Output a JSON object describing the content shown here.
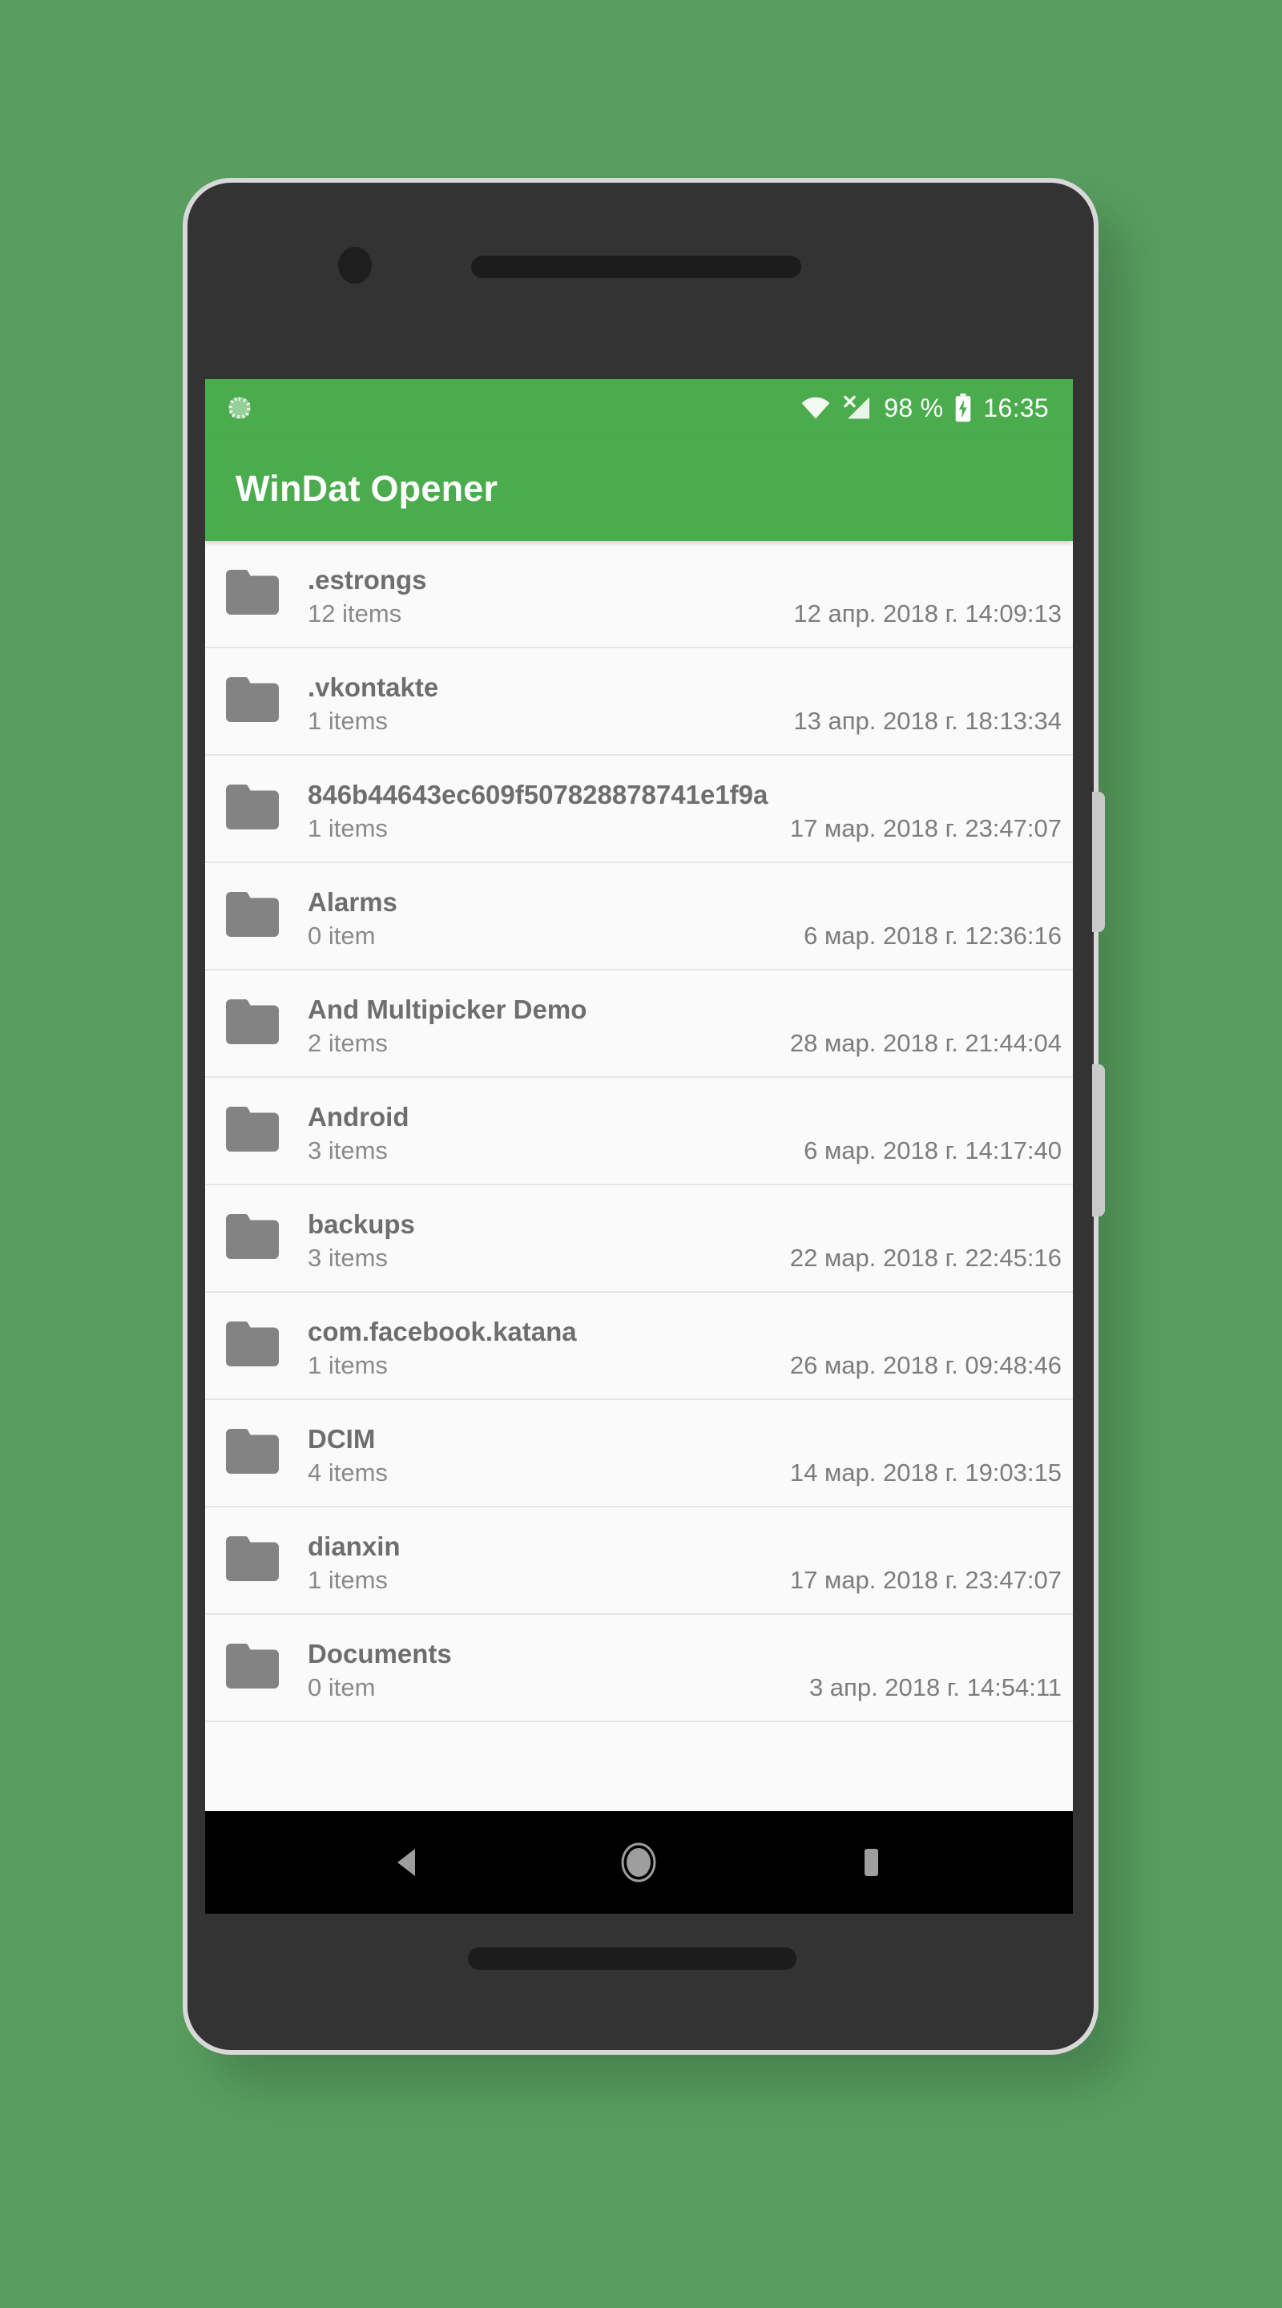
{
  "colors": {
    "background_green": "#589e5f",
    "app_bar_green": "#4bac4e",
    "screen_background": "#fafafa",
    "folder_icon_gray": "#838383",
    "nav_bar_black": "#000000"
  },
  "device": {
    "frame_label": "android-phone-frame",
    "front_camera": "front-camera",
    "earpiece": "earpiece-speaker",
    "bottom_speaker": "bottom-speaker",
    "power_button": "power-button",
    "volume_button": "volume-button"
  },
  "status_bar": {
    "sync_icon": "sync-spinner-icon",
    "wifi_icon": "wifi-icon",
    "signal_icon": "cellular-signal-off-icon",
    "battery_percent": "98 %",
    "battery_icon": "battery-charging-icon",
    "clock": "16:35"
  },
  "app_bar": {
    "title": "WinDat Opener"
  },
  "file_list": {
    "rows": [
      {
        "name": ".estrongs",
        "count": "12 items",
        "date": "12 апр. 2018 г. 14:09:13",
        "icon": "folder-icon"
      },
      {
        "name": ".vkontakte",
        "count": "1 items",
        "date": "13 апр. 2018 г. 18:13:34",
        "icon": "folder-icon"
      },
      {
        "name": "846b44643ec609f507828878741e1f9a",
        "count": "1 items",
        "date": "17 мар. 2018 г. 23:47:07",
        "icon": "folder-icon"
      },
      {
        "name": "Alarms",
        "count": "0 item",
        "date": "6 мар. 2018 г. 12:36:16",
        "icon": "folder-icon"
      },
      {
        "name": "And Multipicker Demo",
        "count": "2 items",
        "date": "28 мар. 2018 г. 21:44:04",
        "icon": "folder-icon"
      },
      {
        "name": "Android",
        "count": "3 items",
        "date": "6 мар. 2018 г. 14:17:40",
        "icon": "folder-icon"
      },
      {
        "name": "backups",
        "count": "3 items",
        "date": "22 мар. 2018 г. 22:45:16",
        "icon": "folder-icon"
      },
      {
        "name": "com.facebook.katana",
        "count": "1 items",
        "date": "26 мар. 2018 г. 09:48:46",
        "icon": "folder-icon"
      },
      {
        "name": "DCIM",
        "count": "4 items",
        "date": "14 мар. 2018 г. 19:03:15",
        "icon": "folder-icon"
      },
      {
        "name": "dianxin",
        "count": "1 items",
        "date": "17 мар. 2018 г. 23:47:07",
        "icon": "folder-icon"
      },
      {
        "name": "Documents",
        "count": "0 item",
        "date": "3 апр. 2018 г. 14:54:11",
        "icon": "folder-icon"
      }
    ]
  },
  "nav_bar": {
    "back": "back-triangle-icon",
    "home": "home-circle-icon",
    "recents": "recents-square-icon"
  }
}
